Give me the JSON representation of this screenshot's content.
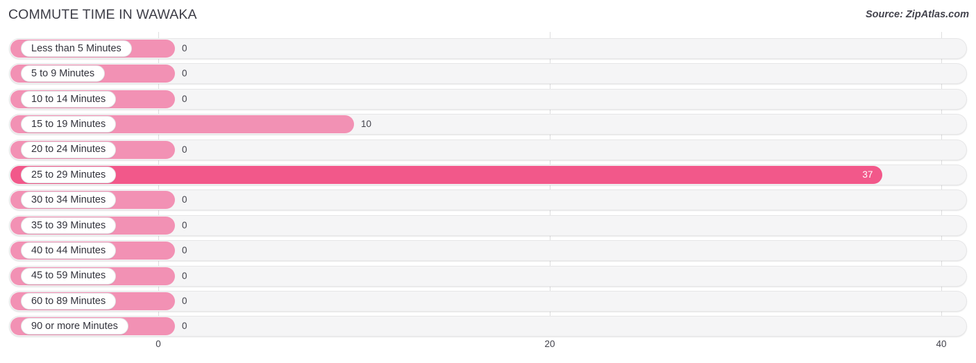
{
  "header": {
    "title": "COMMUTE TIME IN WAWAKA",
    "source": "Source: ZipAtlas.com"
  },
  "colors": {
    "bar_light": "#f291b4",
    "bar_bold": "#f2588a",
    "track": "#f5f5f6",
    "pill": "#ffffff",
    "text": "#33333c",
    "gridline": "#dededf"
  },
  "chart_data": {
    "type": "bar",
    "orientation": "horizontal",
    "title": "COMMUTE TIME IN WAWAKA",
    "xlabel": "",
    "ylabel": "",
    "xlim": [
      0,
      40
    ],
    "grid": true,
    "legend": "none",
    "xticks": [
      "0",
      "20",
      "40"
    ],
    "xtick_values": [
      0,
      20,
      40
    ],
    "categories": [
      "Less than 5 Minutes",
      "5 to 9 Minutes",
      "10 to 14 Minutes",
      "15 to 19 Minutes",
      "20 to 24 Minutes",
      "25 to 29 Minutes",
      "30 to 34 Minutes",
      "35 to 39 Minutes",
      "40 to 44 Minutes",
      "45 to 59 Minutes",
      "60 to 89 Minutes",
      "90 or more Minutes"
    ],
    "values": [
      0,
      0,
      0,
      10,
      0,
      37,
      0,
      0,
      0,
      0,
      0,
      0
    ],
    "value_labels": [
      "0",
      "0",
      "0",
      "10",
      "0",
      "37",
      "0",
      "0",
      "0",
      "0",
      "0",
      "0"
    ]
  },
  "rows": [
    {
      "label": "Less than 5 Minutes",
      "value": 0,
      "value_label": "0",
      "inside": false
    },
    {
      "label": "5 to 9 Minutes",
      "value": 0,
      "value_label": "0",
      "inside": false
    },
    {
      "label": "10 to 14 Minutes",
      "value": 0,
      "value_label": "0",
      "inside": false
    },
    {
      "label": "15 to 19 Minutes",
      "value": 10,
      "value_label": "10",
      "inside": false
    },
    {
      "label": "20 to 24 Minutes",
      "value": 0,
      "value_label": "0",
      "inside": false
    },
    {
      "label": "25 to 29 Minutes",
      "value": 37,
      "value_label": "37",
      "inside": true
    },
    {
      "label": "30 to 34 Minutes",
      "value": 0,
      "value_label": "0",
      "inside": false
    },
    {
      "label": "35 to 39 Minutes",
      "value": 0,
      "value_label": "0",
      "inside": false
    },
    {
      "label": "40 to 44 Minutes",
      "value": 0,
      "value_label": "0",
      "inside": false
    },
    {
      "label": "45 to 59 Minutes",
      "value": 0,
      "value_label": "0",
      "inside": false
    },
    {
      "label": "60 to 89 Minutes",
      "value": 0,
      "value_label": "0",
      "inside": false
    },
    {
      "label": "90 or more Minutes",
      "value": 0,
      "value_label": "0",
      "inside": false
    }
  ],
  "axis": {
    "ticks": [
      "0",
      "20",
      "40"
    ]
  }
}
